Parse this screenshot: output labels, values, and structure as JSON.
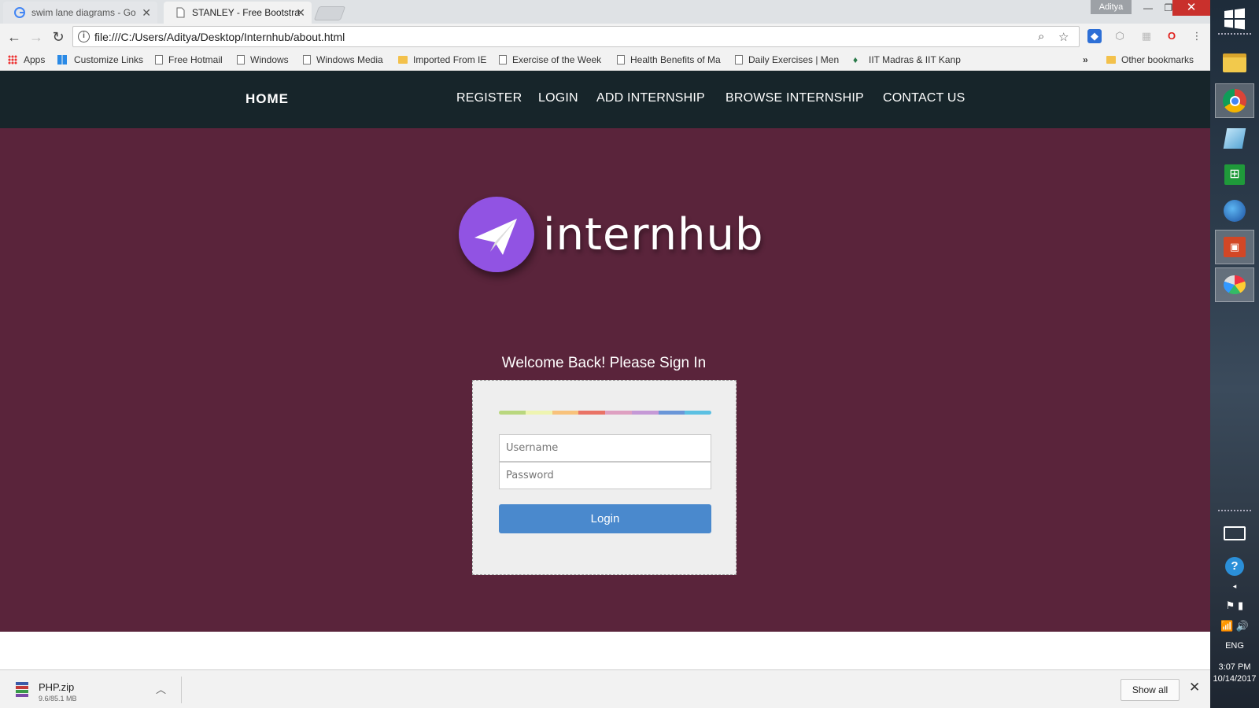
{
  "browser": {
    "tabs": [
      {
        "title": "swim lane diagrams - Go",
        "active": false
      },
      {
        "title": "STANLEY - Free Bootstra",
        "active": true
      }
    ],
    "profile_name": "Aditya",
    "url": "file:///C:/Users/Aditya/Desktop/Internhub/about.html",
    "bookmarks": [
      {
        "label": "Apps",
        "icon": "apps-grid-icon"
      },
      {
        "label": "Customize Links",
        "icon": "windows-logo-icon"
      },
      {
        "label": "Free Hotmail",
        "icon": "page-icon"
      },
      {
        "label": "Windows",
        "icon": "page-icon"
      },
      {
        "label": "Windows Media",
        "icon": "page-icon"
      },
      {
        "label": "Imported From IE",
        "icon": "folder-icon"
      },
      {
        "label": "Exercise of the Week",
        "icon": "page-icon"
      },
      {
        "label": "Health Benefits of Ma",
        "icon": "page-icon"
      },
      {
        "label": "Daily Exercises | Men",
        "icon": "page-icon"
      },
      {
        "label": "IIT Madras & IIT Kanp",
        "icon": "leaf-icon"
      }
    ],
    "other_bookmarks": "Other bookmarks",
    "overflow": "»"
  },
  "site": {
    "brand": "HOME",
    "nav": [
      "REGISTER",
      "LOGIN",
      "ADD INTERNSHIP",
      "BROWSE INTERNSHIP",
      "CONTACT US"
    ],
    "logo_text": "internhub",
    "welcome": "Welcome Back! Please Sign In",
    "username_placeholder": "Username",
    "password_placeholder": "Password",
    "login_button": "Login",
    "stripe_colors": [
      "#b9d77e",
      "#eef4b0",
      "#f8c27b",
      "#e97366",
      "#dea0c1",
      "#c599d6",
      "#6a96d8",
      "#5cc0e2"
    ],
    "colors": {
      "nav_bg": "#17252a",
      "hero_bg": "#5a243b",
      "logo_circle": "#9153e3",
      "button": "#4a89cd"
    }
  },
  "downloads": {
    "file_name": "PHP.zip",
    "progress": "9.6/85.1 MB",
    "show_all": "Show all"
  },
  "taskbar": {
    "language": "ENG",
    "time": "3:07 PM",
    "date": "10/14/2017"
  }
}
